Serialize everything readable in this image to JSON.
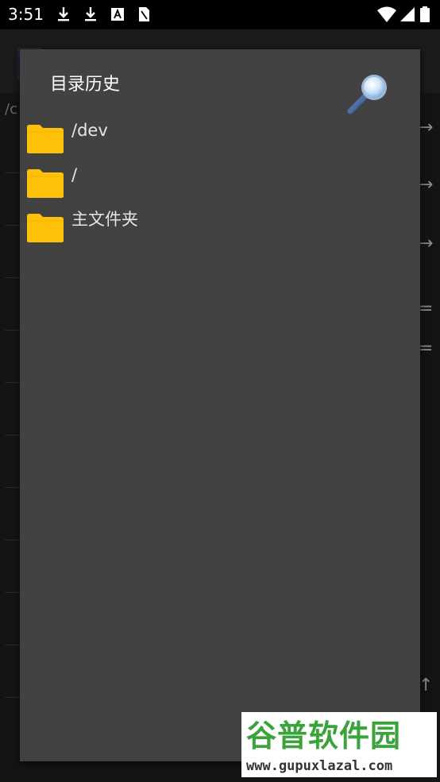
{
  "status_bar": {
    "time": "3:51",
    "left_icons": [
      "download-icon",
      "download-icon",
      "font-icon",
      "sim-icon"
    ],
    "right_icons": [
      "wifi-icon",
      "signal-icon",
      "battery-icon"
    ]
  },
  "background": {
    "path_fragment": "/c"
  },
  "dialog": {
    "title": "目录历史",
    "search_icon": "magnifier-icon",
    "items": [
      {
        "label": "/dev",
        "icon": "folder-icon"
      },
      {
        "label": "/",
        "icon": "folder-icon"
      },
      {
        "label": "主文件夹",
        "icon": "folder-icon"
      }
    ]
  },
  "watermark": {
    "main": "谷普软件园",
    "sub": "www.gupuxlazal.com"
  },
  "colors": {
    "dialog_bg": "#424242",
    "folder": "#FFC107",
    "status_bar_bg": "#000000"
  }
}
